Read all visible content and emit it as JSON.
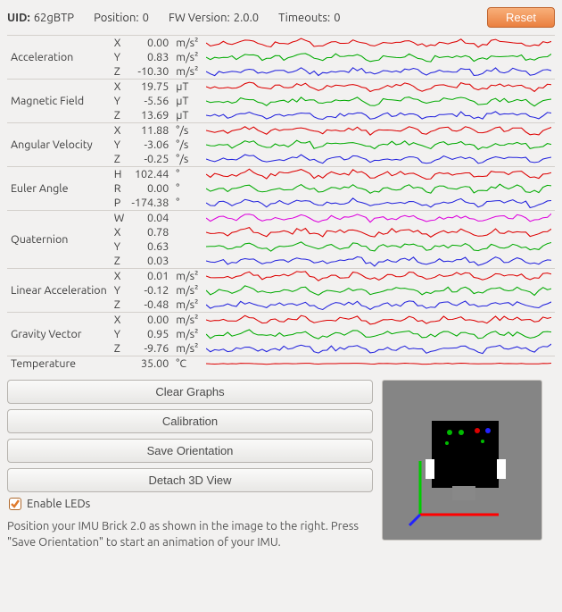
{
  "header": {
    "uid_label": "UID:",
    "uid_value": "62gBTP",
    "position_label": "Position:",
    "position_value": "0",
    "fw_label": "FW Version:",
    "fw_value": "2.0.0",
    "timeouts_label": "Timeouts:",
    "timeouts_value": "0",
    "reset_label": "Reset"
  },
  "sensors": [
    {
      "name": "Acceleration",
      "rows": [
        {
          "axis": "X",
          "value": "0.00",
          "unit": "m/s²",
          "color": "#d00"
        },
        {
          "axis": "Y",
          "value": "0.83",
          "unit": "m/s²",
          "color": "#0a0"
        },
        {
          "axis": "Z",
          "value": "-10.30",
          "unit": "m/s²",
          "color": "#22d"
        }
      ]
    },
    {
      "name": "Magnetic Field",
      "rows": [
        {
          "axis": "X",
          "value": "19.75",
          "unit": "µT",
          "color": "#d00"
        },
        {
          "axis": "Y",
          "value": "-5.56",
          "unit": "µT",
          "color": "#0a0"
        },
        {
          "axis": "Z",
          "value": "13.69",
          "unit": "µT",
          "color": "#22d"
        }
      ]
    },
    {
      "name": "Angular Velocity",
      "rows": [
        {
          "axis": "X",
          "value": "11.88",
          "unit": "°/s",
          "color": "#d00"
        },
        {
          "axis": "Y",
          "value": "-3.06",
          "unit": "°/s",
          "color": "#0a0"
        },
        {
          "axis": "Z",
          "value": "-0.25",
          "unit": "°/s",
          "color": "#22d"
        }
      ]
    },
    {
      "name": "Euler Angle",
      "rows": [
        {
          "axis": "H",
          "value": "102.44",
          "unit": "°",
          "color": "#d00"
        },
        {
          "axis": "R",
          "value": "0.00",
          "unit": "°",
          "color": "#0a0"
        },
        {
          "axis": "P",
          "value": "-174.38",
          "unit": "°",
          "color": "#22d"
        }
      ]
    },
    {
      "name": "Quaternion",
      "rows": [
        {
          "axis": "W",
          "value": "0.04",
          "unit": "",
          "color": "#d0d"
        },
        {
          "axis": "X",
          "value": "0.78",
          "unit": "",
          "color": "#d00"
        },
        {
          "axis": "Y",
          "value": "0.63",
          "unit": "",
          "color": "#0a0"
        },
        {
          "axis": "Z",
          "value": "0.03",
          "unit": "",
          "color": "#22d"
        }
      ]
    },
    {
      "name": "Linear Acceleration",
      "rows": [
        {
          "axis": "X",
          "value": "0.01",
          "unit": "m/s²",
          "color": "#d00"
        },
        {
          "axis": "Y",
          "value": "-0.12",
          "unit": "m/s²",
          "color": "#0a0"
        },
        {
          "axis": "Z",
          "value": "-0.48",
          "unit": "m/s²",
          "color": "#22d"
        }
      ]
    },
    {
      "name": "Gravity Vector",
      "rows": [
        {
          "axis": "X",
          "value": "0.00",
          "unit": "m/s²",
          "color": "#d00"
        },
        {
          "axis": "Y",
          "value": "0.95",
          "unit": "m/s²",
          "color": "#0a0"
        },
        {
          "axis": "Z",
          "value": "-9.76",
          "unit": "m/s²",
          "color": "#22d"
        }
      ]
    },
    {
      "name": "Temperature",
      "rows": [
        {
          "axis": "",
          "value": "35.00",
          "unit": "°C",
          "color": "#d00"
        }
      ]
    }
  ],
  "buttons": {
    "clear": "Clear Graphs",
    "calibration": "Calibration",
    "save_orientation": "Save Orientation",
    "detach": "Detach 3D View"
  },
  "enable_leds_label": "Enable LEDs",
  "instruction": "Position your IMU Brick 2.0 as shown in the image to the right. Press \"Save Orientation\" to start an animation of your IMU."
}
